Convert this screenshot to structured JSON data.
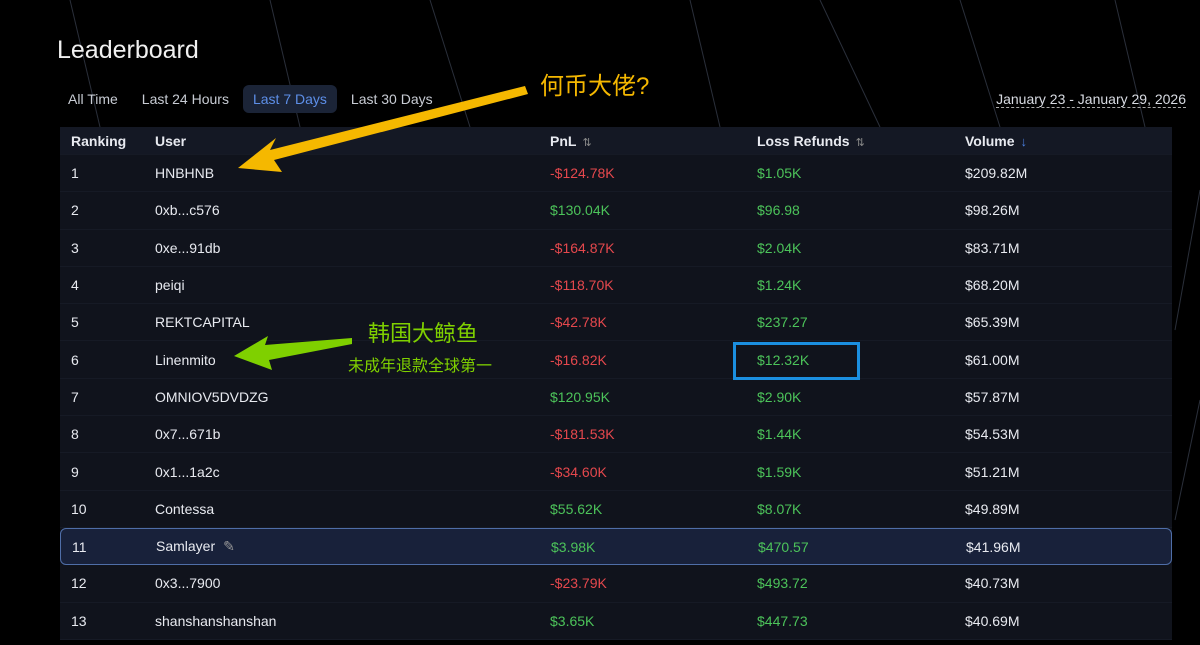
{
  "title": "Leaderboard",
  "tabs": [
    "All Time",
    "Last 24 Hours",
    "Last 7 Days",
    "Last 30 Days"
  ],
  "active_tab": "Last 7 Days",
  "date_range": "January 23 - January 29, 2026",
  "columns": {
    "ranking": "Ranking",
    "user": "User",
    "pnl": "PnL",
    "loss_refunds": "Loss Refunds",
    "volume": "Volume"
  },
  "sort_icons": {
    "pnl": "⇅",
    "loss_refunds": "⇅",
    "volume": "↓"
  },
  "rows": [
    {
      "rank": "1",
      "user": "HNBHNB",
      "pnl": "-$124.78K",
      "refund": "$1.05K",
      "volume": "$209.82M"
    },
    {
      "rank": "2",
      "user": "0xb...c576",
      "pnl": "$130.04K",
      "refund": "$96.98",
      "volume": "$98.26M"
    },
    {
      "rank": "3",
      "user": "0xe...91db",
      "pnl": "-$164.87K",
      "refund": "$2.04K",
      "volume": "$83.71M"
    },
    {
      "rank": "4",
      "user": "peiqi",
      "pnl": "-$118.70K",
      "refund": "$1.24K",
      "volume": "$68.20M"
    },
    {
      "rank": "5",
      "user": "REKTCAPITAL",
      "pnl": "-$42.78K",
      "refund": "$237.27",
      "volume": "$65.39M"
    },
    {
      "rank": "6",
      "user": "Linenmito",
      "pnl": "-$16.82K",
      "refund": "$12.32K",
      "volume": "$61.00M"
    },
    {
      "rank": "7",
      "user": "OMNIOV5DVDZG",
      "pnl": "$120.95K",
      "refund": "$2.90K",
      "volume": "$57.87M"
    },
    {
      "rank": "8",
      "user": "0x7...671b",
      "pnl": "-$181.53K",
      "refund": "$1.44K",
      "volume": "$54.53M"
    },
    {
      "rank": "9",
      "user": "0x1...1a2c",
      "pnl": "-$34.60K",
      "refund": "$1.59K",
      "volume": "$51.21M"
    },
    {
      "rank": "10",
      "user": "Contessa",
      "pnl": "$55.62K",
      "refund": "$8.07K",
      "volume": "$49.89M"
    },
    {
      "rank": "11",
      "user": "Samlayer",
      "pnl": "$3.98K",
      "refund": "$470.57",
      "volume": "$41.96M",
      "current_user": true
    },
    {
      "rank": "12",
      "user": "0x3...7900",
      "pnl": "-$23.79K",
      "refund": "$493.72",
      "volume": "$40.73M"
    },
    {
      "rank": "13",
      "user": "shanshanshanshan",
      "pnl": "$3.65K",
      "refund": "$447.73",
      "volume": "$40.69M"
    }
  ],
  "annotations": {
    "a1": "何币大佬?",
    "a2": "韩国大鲸鱼",
    "a3": "未成年退款全球第一"
  },
  "colors": {
    "negative": "#e5484d",
    "positive": "#4cc35a",
    "accent": "#5d8fe8",
    "yellow": "#f5b800",
    "green": "#7fd000",
    "box": "#1b8fe0"
  }
}
